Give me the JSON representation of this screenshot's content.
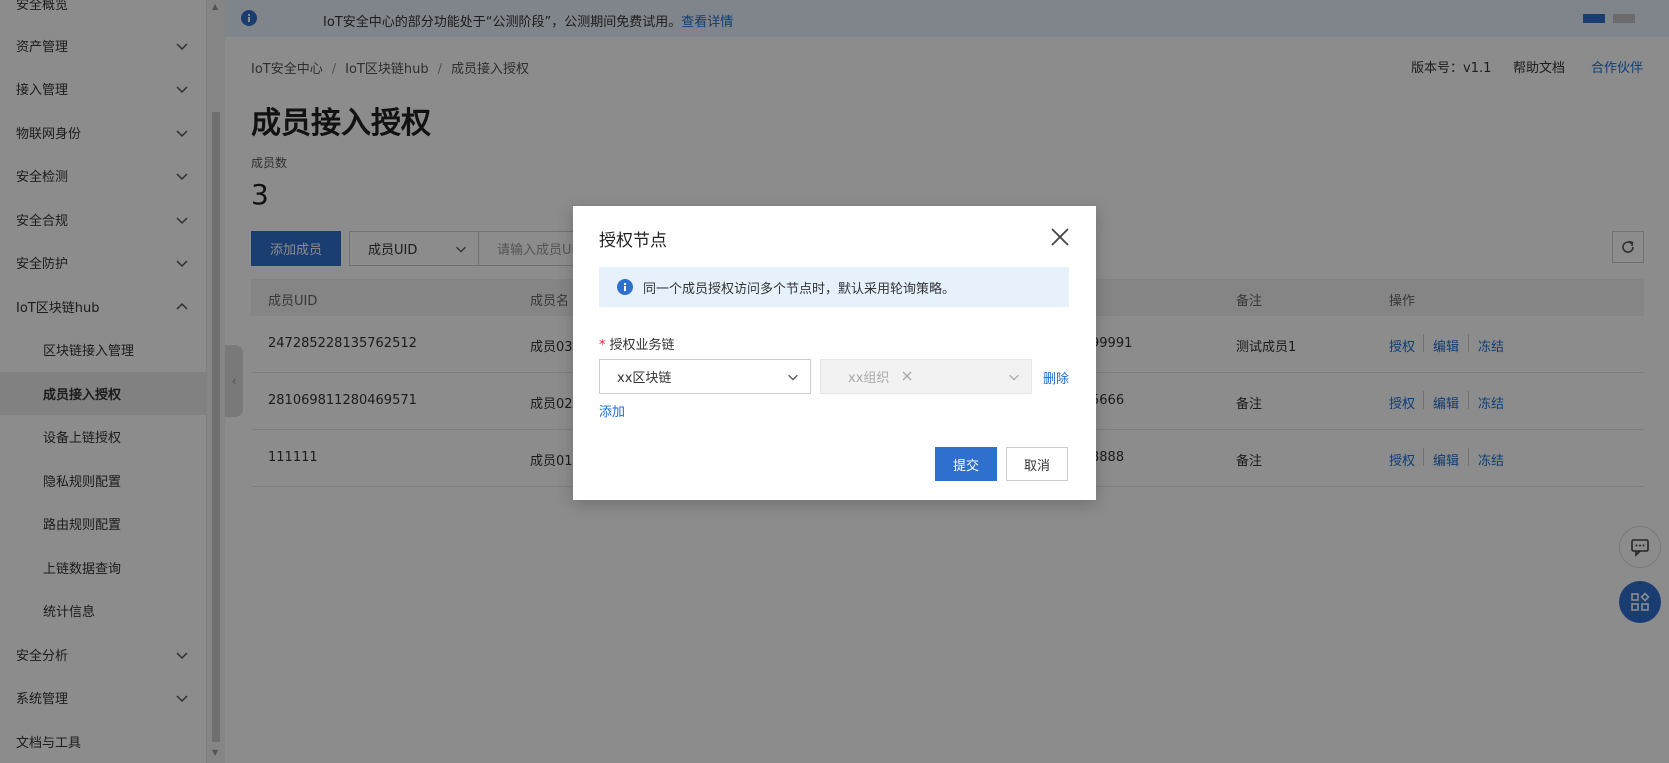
{
  "sidebar": {
    "items": [
      {
        "label": "安全概览"
      },
      {
        "label": "资产管理"
      },
      {
        "label": "接入管理"
      },
      {
        "label": "物联网身份"
      },
      {
        "label": "安全检测"
      },
      {
        "label": "安全合规"
      },
      {
        "label": "安全防护"
      },
      {
        "label": "IoT区块链hub"
      },
      {
        "label": "区块链接入管理"
      },
      {
        "label": "成员接入授权"
      },
      {
        "label": "设备上链授权"
      },
      {
        "label": "隐私规则配置"
      },
      {
        "label": "路由规则配置"
      },
      {
        "label": "上链数据查询"
      },
      {
        "label": "统计信息"
      },
      {
        "label": "安全分析"
      },
      {
        "label": "系统管理"
      },
      {
        "label": "文档与工具"
      }
    ]
  },
  "banner": {
    "text": "IoT安全中心的部分功能处于“公测阶段”，公测期间免费试用。",
    "link": "查看详情"
  },
  "breadcrumb": [
    "IoT安全中心",
    "IoT区块链hub",
    "成员接入授权"
  ],
  "toplinks": {
    "version": "版本号：v1.1",
    "help": "帮助文档",
    "partner": "合作伙伴"
  },
  "page": {
    "title": "成员接入授权",
    "stat_label": "成员数",
    "stat_value": "3"
  },
  "toolbar": {
    "add_label": "添加成员",
    "filter_value": "成员UID",
    "search_placeholder": "请输入成员UID"
  },
  "table": {
    "headers": [
      "成员UID",
      "成员名",
      "备注",
      "操作"
    ],
    "rows": [
      {
        "uid": "247285228135762512",
        "name": "成员03",
        "num": "99991",
        "note": "测试成员1"
      },
      {
        "uid": "281069811280469571",
        "name": "成员02",
        "num": "5666",
        "note": "备注"
      },
      {
        "uid": "111111",
        "name": "成员01",
        "num": "8888",
        "note": "备注"
      }
    ],
    "actions": {
      "authorize": "授权",
      "edit": "编辑",
      "freeze": "冻结"
    }
  },
  "modal": {
    "title": "授权节点",
    "tip": "同一个成员授权访问多个节点时，默认采用轮询策略。",
    "field_label": "授权业务链",
    "chain_value": "xx区块链",
    "org_value": "xx组织",
    "delete_label": "删除",
    "add_label": "添加",
    "submit_label": "提交",
    "cancel_label": "取消"
  },
  "colors": {
    "primary": "#2f6fce",
    "link": "#1a6fd4",
    "tip_bg": "#e6f1fc"
  }
}
